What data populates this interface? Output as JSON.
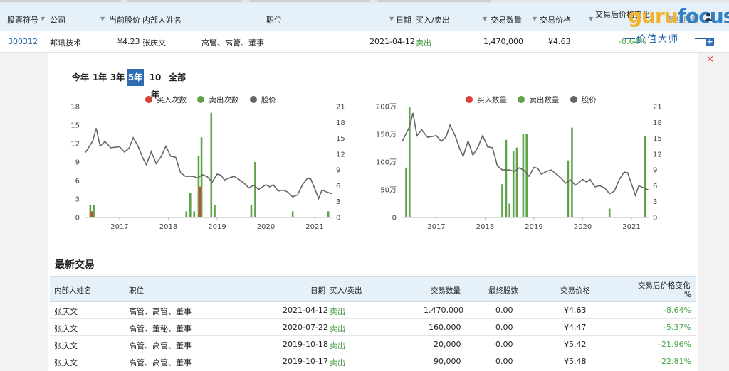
{
  "top_table": {
    "headers": {
      "symbol": "股票符号",
      "company": "公司",
      "price": "当前股价",
      "insider": "内部人姓名",
      "position": "职位",
      "date": "日期",
      "buy_sell": "买入/卖出",
      "quantity": "交易数量",
      "trade_price": "交易价格",
      "change": "交易后价格变化",
      "final_shares": "最终股数"
    },
    "row": {
      "symbol": "300312",
      "company": "邦讯技术",
      "price": "¥4.23",
      "insider": "张庆文",
      "position": "高管、高管、董事",
      "date": "2021-04-12",
      "buy_sell": "卖出",
      "quantity": "1,470,000",
      "trade_price": "¥4.63",
      "change": "-8.64%"
    }
  },
  "logo": {
    "guru": "guru",
    "focus": "focus",
    "subtitle": "价值大师"
  },
  "controls": {
    "plus": "+",
    "close": "×",
    "person_icon": "person-icon"
  },
  "range_tabs": [
    "今年",
    "1年",
    "3年",
    "5年",
    "10年",
    "全部"
  ],
  "active_range": "5年",
  "colors": {
    "buy": "#d9413b",
    "sell": "#5ea34a",
    "price": "#666666",
    "accent": "#2f6db3"
  },
  "chart_data": [
    {
      "type": "bar",
      "legend": [
        "买入次数",
        "卖出次数",
        "股价"
      ],
      "x_ticks": [
        "2017",
        "2018",
        "2019",
        "2020",
        "2021"
      ],
      "y_left_ticks": [
        "0",
        "3",
        "6",
        "9",
        "12",
        "15",
        "18"
      ],
      "y_right_ticks": [
        "0",
        "3",
        "6",
        "9",
        "12",
        "15",
        "18",
        "21"
      ],
      "ylim_left": [
        0,
        18
      ],
      "ylim_right": [
        0,
        21
      ],
      "xlim": [
        2016.3,
        2021.35
      ],
      "sell_bars": [
        {
          "x": 2016.4,
          "y": 2
        },
        {
          "x": 2016.47,
          "y": 2
        },
        {
          "x": 2018.37,
          "y": 1
        },
        {
          "x": 2018.45,
          "y": 4
        },
        {
          "x": 2018.53,
          "y": 1
        },
        {
          "x": 2018.62,
          "y": 10
        },
        {
          "x": 2018.68,
          "y": 13
        },
        {
          "x": 2018.88,
          "y": 17
        },
        {
          "x": 2018.95,
          "y": 2
        },
        {
          "x": 2019.7,
          "y": 2
        },
        {
          "x": 2019.78,
          "y": 9
        },
        {
          "x": 2020.55,
          "y": 1
        },
        {
          "x": 2021.28,
          "y": 1
        }
      ],
      "buy_bars": [
        {
          "x": 2016.43,
          "y": 1
        },
        {
          "x": 2018.65,
          "y": 5
        }
      ],
      "price": [
        {
          "x": 2016.3,
          "y": 12.3
        },
        {
          "x": 2016.45,
          "y": 14.5
        },
        {
          "x": 2016.52,
          "y": 16.9
        },
        {
          "x": 2016.6,
          "y": 13.5
        },
        {
          "x": 2016.7,
          "y": 14.4
        },
        {
          "x": 2016.82,
          "y": 13.2
        },
        {
          "x": 2017.0,
          "y": 13.4
        },
        {
          "x": 2017.1,
          "y": 12.4
        },
        {
          "x": 2017.2,
          "y": 13.2
        },
        {
          "x": 2017.28,
          "y": 15.1
        },
        {
          "x": 2017.38,
          "y": 13.5
        },
        {
          "x": 2017.48,
          "y": 11.2
        },
        {
          "x": 2017.55,
          "y": 10.0
        },
        {
          "x": 2017.65,
          "y": 12.5
        },
        {
          "x": 2017.75,
          "y": 10.2
        },
        {
          "x": 2017.85,
          "y": 11.5
        },
        {
          "x": 2017.95,
          "y": 13.5
        },
        {
          "x": 2018.05,
          "y": 11.6
        },
        {
          "x": 2018.15,
          "y": 11.4
        },
        {
          "x": 2018.25,
          "y": 8.5
        },
        {
          "x": 2018.35,
          "y": 7.8
        },
        {
          "x": 2018.5,
          "y": 7.8
        },
        {
          "x": 2018.6,
          "y": 7.5
        },
        {
          "x": 2018.7,
          "y": 8.1
        },
        {
          "x": 2018.8,
          "y": 7.7
        },
        {
          "x": 2018.9,
          "y": 6.7
        },
        {
          "x": 2019.0,
          "y": 8.2
        },
        {
          "x": 2019.08,
          "y": 8.0
        },
        {
          "x": 2019.15,
          "y": 7.1
        },
        {
          "x": 2019.25,
          "y": 7.5
        },
        {
          "x": 2019.35,
          "y": 7.8
        },
        {
          "x": 2019.45,
          "y": 7.2
        },
        {
          "x": 2019.55,
          "y": 6.5
        },
        {
          "x": 2019.65,
          "y": 5.6
        },
        {
          "x": 2019.75,
          "y": 6.1
        },
        {
          "x": 2019.85,
          "y": 5.3
        },
        {
          "x": 2020.0,
          "y": 6.2
        },
        {
          "x": 2020.08,
          "y": 5.8
        },
        {
          "x": 2020.15,
          "y": 6.2
        },
        {
          "x": 2020.25,
          "y": 5.0
        },
        {
          "x": 2020.35,
          "y": 5.2
        },
        {
          "x": 2020.45,
          "y": 4.8
        },
        {
          "x": 2020.55,
          "y": 3.9
        },
        {
          "x": 2020.65,
          "y": 4.3
        },
        {
          "x": 2020.75,
          "y": 6.2
        },
        {
          "x": 2020.85,
          "y": 7.4
        },
        {
          "x": 2020.92,
          "y": 7.3
        },
        {
          "x": 2021.0,
          "y": 5.5
        },
        {
          "x": 2021.08,
          "y": 3.6
        },
        {
          "x": 2021.15,
          "y": 5.2
        },
        {
          "x": 2021.25,
          "y": 4.8
        },
        {
          "x": 2021.35,
          "y": 4.5
        }
      ]
    },
    {
      "type": "bar",
      "legend": [
        "买入数量",
        "卖出数量",
        "股价"
      ],
      "x_ticks": [
        "2017",
        "2018",
        "2019",
        "2020",
        "2021"
      ],
      "y_left_ticks": [
        "0",
        "50万",
        "100万",
        "150万",
        "200万"
      ],
      "y_right_ticks": [
        "0",
        "3",
        "6",
        "9",
        "12",
        "15",
        "18",
        "21"
      ],
      "ylim_left": [
        0,
        200
      ],
      "ylim_right": [
        0,
        21
      ],
      "xlim": [
        2016.3,
        2021.35
      ],
      "sell_bars": [
        {
          "x": 2016.38,
          "y": 90
        },
        {
          "x": 2016.45,
          "y": 200
        },
        {
          "x": 2018.35,
          "y": 60
        },
        {
          "x": 2018.43,
          "y": 140
        },
        {
          "x": 2018.5,
          "y": 25
        },
        {
          "x": 2018.58,
          "y": 120
        },
        {
          "x": 2018.65,
          "y": 126
        },
        {
          "x": 2018.78,
          "y": 150
        },
        {
          "x": 2018.85,
          "y": 150
        },
        {
          "x": 2019.7,
          "y": 103
        },
        {
          "x": 2019.78,
          "y": 162
        },
        {
          "x": 2020.55,
          "y": 16
        },
        {
          "x": 2021.28,
          "y": 147
        }
      ],
      "buy_bars": [],
      "price": [
        {
          "x": 2016.3,
          "y": 14.4
        },
        {
          "x": 2016.45,
          "y": 17.2
        },
        {
          "x": 2016.52,
          "y": 19.8
        },
        {
          "x": 2016.6,
          "y": 15.5
        },
        {
          "x": 2016.7,
          "y": 16.6
        },
        {
          "x": 2016.82,
          "y": 15.2
        },
        {
          "x": 2017.0,
          "y": 15.5
        },
        {
          "x": 2017.1,
          "y": 14.4
        },
        {
          "x": 2017.2,
          "y": 15.3
        },
        {
          "x": 2017.28,
          "y": 17.5
        },
        {
          "x": 2017.38,
          "y": 15.6
        },
        {
          "x": 2017.48,
          "y": 13.0
        },
        {
          "x": 2017.55,
          "y": 11.6
        },
        {
          "x": 2017.65,
          "y": 14.5
        },
        {
          "x": 2017.75,
          "y": 11.8
        },
        {
          "x": 2017.85,
          "y": 13.3
        },
        {
          "x": 2017.95,
          "y": 15.5
        },
        {
          "x": 2018.05,
          "y": 13.4
        },
        {
          "x": 2018.15,
          "y": 13.2
        },
        {
          "x": 2018.25,
          "y": 9.8
        },
        {
          "x": 2018.35,
          "y": 9.0
        },
        {
          "x": 2018.5,
          "y": 9.0
        },
        {
          "x": 2018.6,
          "y": 8.7
        },
        {
          "x": 2018.7,
          "y": 9.4
        },
        {
          "x": 2018.8,
          "y": 8.9
        },
        {
          "x": 2018.9,
          "y": 7.8
        },
        {
          "x": 2019.0,
          "y": 9.5
        },
        {
          "x": 2019.08,
          "y": 9.3
        },
        {
          "x": 2019.15,
          "y": 8.2
        },
        {
          "x": 2019.25,
          "y": 8.7
        },
        {
          "x": 2019.35,
          "y": 9.0
        },
        {
          "x": 2019.45,
          "y": 8.3
        },
        {
          "x": 2019.55,
          "y": 7.5
        },
        {
          "x": 2019.65,
          "y": 6.5
        },
        {
          "x": 2019.75,
          "y": 7.1
        },
        {
          "x": 2019.85,
          "y": 6.1
        },
        {
          "x": 2020.0,
          "y": 7.2
        },
        {
          "x": 2020.08,
          "y": 6.7
        },
        {
          "x": 2020.15,
          "y": 7.2
        },
        {
          "x": 2020.25,
          "y": 5.8
        },
        {
          "x": 2020.35,
          "y": 6.0
        },
        {
          "x": 2020.45,
          "y": 5.6
        },
        {
          "x": 2020.55,
          "y": 4.5
        },
        {
          "x": 2020.65,
          "y": 5.0
        },
        {
          "x": 2020.75,
          "y": 7.2
        },
        {
          "x": 2020.85,
          "y": 8.6
        },
        {
          "x": 2020.92,
          "y": 8.5
        },
        {
          "x": 2021.0,
          "y": 6.4
        },
        {
          "x": 2021.08,
          "y": 4.2
        },
        {
          "x": 2021.15,
          "y": 6.0
        },
        {
          "x": 2021.25,
          "y": 5.6
        },
        {
          "x": 2021.35,
          "y": 5.2
        }
      ]
    }
  ],
  "latest": {
    "title": "最新交易",
    "headers": {
      "insider": "内部人姓名",
      "position": "职位",
      "date": "日期",
      "buy_sell": "买入/卖出",
      "quantity": "交易数量",
      "final_shares": "最终股数",
      "trade_price": "交易价格",
      "change_line1": "交易后价格变化",
      "change_line2": "%"
    },
    "rows": [
      {
        "insider": "张庆文",
        "position": "高管、高管、董事",
        "date": "2021-04-12",
        "buy_sell": "卖出",
        "quantity": "1,470,000",
        "final_shares": "0.00",
        "trade_price": "¥4.63",
        "change": "-8.64%"
      },
      {
        "insider": "张庆文",
        "position": "高管、董秘、董事",
        "date": "2020-07-22",
        "buy_sell": "卖出",
        "quantity": "160,000",
        "final_shares": "0.00",
        "trade_price": "¥4.47",
        "change": "-5.37%"
      },
      {
        "insider": "张庆文",
        "position": "高管、高管、董事",
        "date": "2019-10-18",
        "buy_sell": "卖出",
        "quantity": "20,000",
        "final_shares": "0.00",
        "trade_price": "¥5.42",
        "change": "-21.96%"
      },
      {
        "insider": "张庆文",
        "position": "高管、高管、董事",
        "date": "2019-10-17",
        "buy_sell": "卖出",
        "quantity": "90,000",
        "final_shares": "0.00",
        "trade_price": "¥5.48",
        "change": "-22.81%"
      }
    ]
  }
}
